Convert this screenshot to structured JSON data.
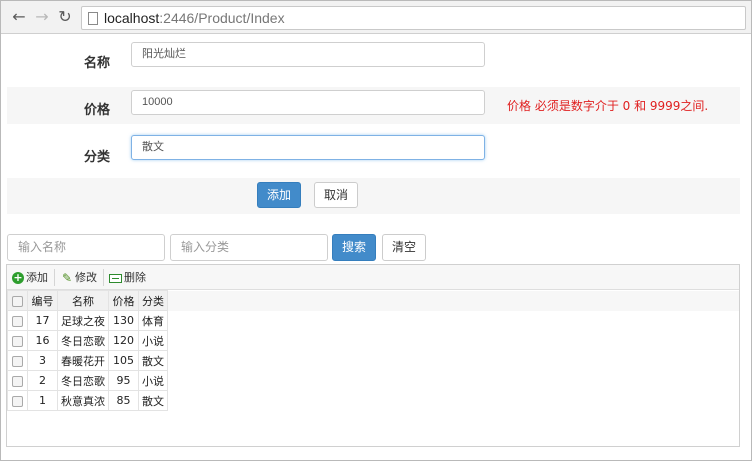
{
  "browser": {
    "url_host": "localhost",
    "url_rest": ":2446/Product/Index"
  },
  "form": {
    "name_label": "名称",
    "name_value": "阳光灿烂",
    "price_label": "价格",
    "price_value": "10000",
    "price_error": "价格 必须是数字介于 0 和 9999之间.",
    "category_label": "分类",
    "category_value": "散文",
    "add_button": "添加",
    "cancel_button": "取消"
  },
  "search": {
    "name_placeholder": "输入名称",
    "category_placeholder": "输入分类",
    "search_button": "搜索",
    "clear_button": "清空"
  },
  "toolbar": {
    "add": "添加",
    "edit": "修改",
    "delete": "删除"
  },
  "grid": {
    "headers": {
      "id": "编号",
      "name": "名称",
      "price": "价格",
      "category": "分类"
    },
    "rows": [
      {
        "id": "17",
        "name": "足球之夜",
        "price": "130",
        "category": "体育"
      },
      {
        "id": "16",
        "name": "冬日恋歌",
        "price": "120",
        "category": "小说"
      },
      {
        "id": "3",
        "name": "春暖花开",
        "price": "105",
        "category": "散文"
      },
      {
        "id": "2",
        "name": "冬日恋歌",
        "price": "95",
        "category": "小说"
      },
      {
        "id": "1",
        "name": "秋意真浓",
        "price": "85",
        "category": "散文"
      }
    ]
  },
  "colors": {
    "primary": "#428bca",
    "error": "#e02020",
    "alt_row": "#f6f6f6"
  }
}
